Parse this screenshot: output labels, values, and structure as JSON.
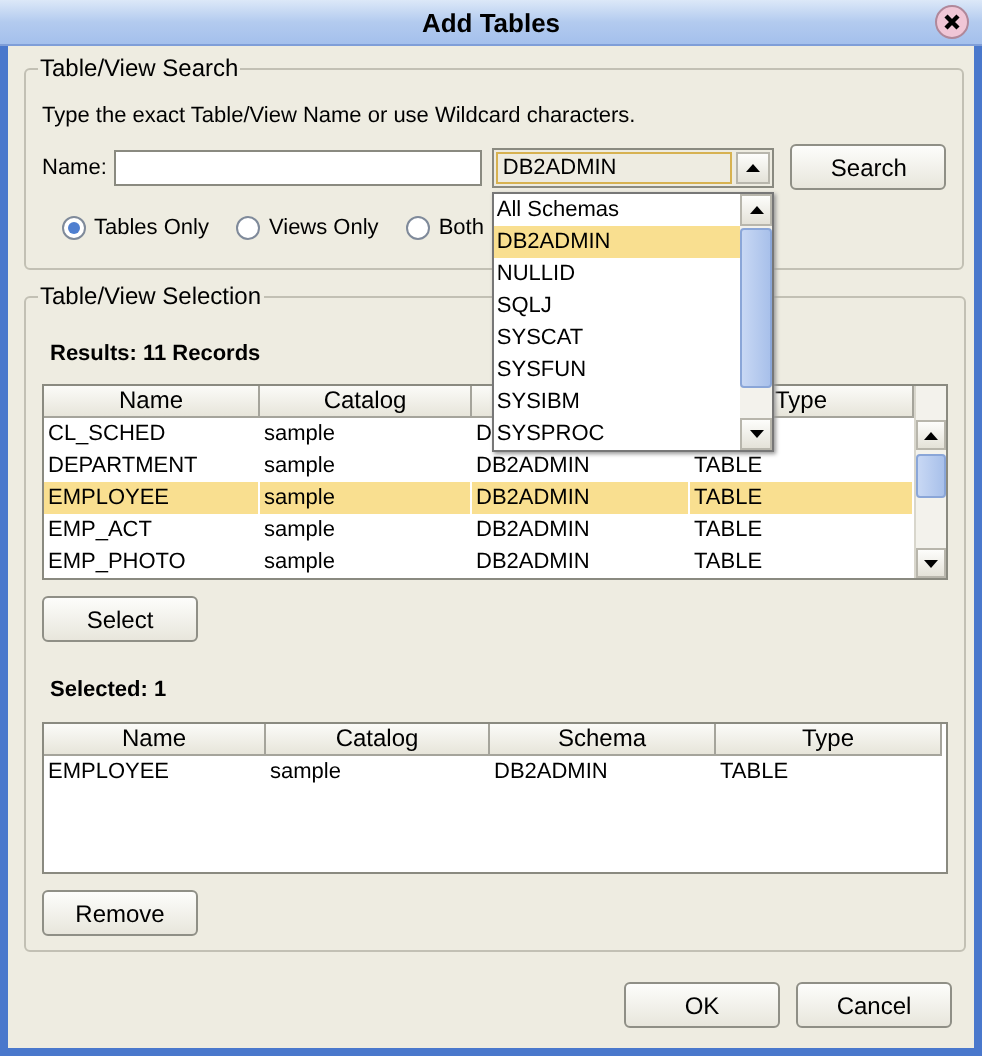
{
  "window": {
    "title": "Add Tables"
  },
  "search": {
    "legend": "Table/View Search",
    "hint": "Type the exact Table/View Name or use Wildcard characters.",
    "name_label": "Name:",
    "schema_value": "DB2ADMIN",
    "expanded": true,
    "search_button": "Search",
    "radios": [
      {
        "label": "Tables Only",
        "selected": true
      },
      {
        "label": "Views Only",
        "selected": false
      },
      {
        "label": "Both",
        "selected": false
      }
    ]
  },
  "schema_list": [
    {
      "label": "All Schemas",
      "selected": false
    },
    {
      "label": "DB2ADMIN",
      "selected": true
    },
    {
      "label": "NULLID",
      "selected": false
    },
    {
      "label": "SQLJ",
      "selected": false
    },
    {
      "label": "SYSCAT",
      "selected": false
    },
    {
      "label": "SYSFUN",
      "selected": false
    },
    {
      "label": "SYSIBM",
      "selected": false
    },
    {
      "label": "SYSPROC",
      "selected": false
    }
  ],
  "selection": {
    "legend": "Table/View Selection",
    "results_label": "Results: 11 Records",
    "results_table": {
      "columns": [
        "Name",
        "Catalog",
        null,
        "Type"
      ],
      "rows": [
        {
          "cells": [
            "CL_SCHED",
            "sample",
            "D",
            null
          ],
          "selected": false
        },
        {
          "cells": [
            "DEPARTMENT",
            "sample",
            "DB2ADMIN",
            "TABLE"
          ],
          "selected": false
        },
        {
          "cells": [
            "EMPLOYEE",
            "sample",
            "DB2ADMIN",
            "TABLE"
          ],
          "selected": true
        },
        {
          "cells": [
            "EMP_ACT",
            "sample",
            "DB2ADMIN",
            "TABLE"
          ],
          "selected": false
        },
        {
          "cells": [
            "EMP_PHOTO",
            "sample",
            "DB2ADMIN",
            "TABLE"
          ],
          "selected": false
        }
      ]
    },
    "select_button": "Select",
    "selected_label": "Selected: 1",
    "selected_table": {
      "columns": [
        "Name",
        "Catalog",
        "Schema",
        "Type"
      ],
      "rows": [
        {
          "cells": [
            "EMPLOYEE",
            "sample",
            "DB2ADMIN",
            "TABLE"
          ],
          "selected": false
        }
      ]
    },
    "remove_button": "Remove"
  },
  "buttons": [
    "OK",
    "Cancel"
  ]
}
